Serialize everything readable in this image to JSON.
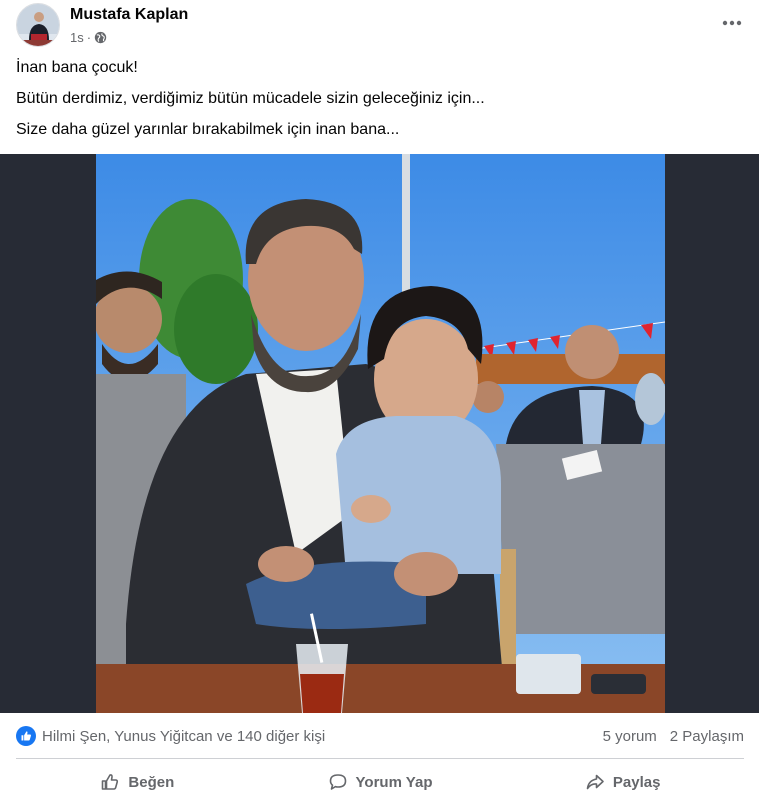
{
  "post": {
    "author": "Mustafa Kaplan",
    "time": "1s",
    "privacy_icon": "globe-icon",
    "menu_icon": "more-horizontal-icon",
    "lines": [
      "İnan bana çocuk!",
      "Bütün derdimiz, verdiğimiz bütün mücadele sizin geleceğiniz için...",
      "Size daha güzel yarınlar bırakabilmek için inan bana..."
    ]
  },
  "photo": {
    "subject": "man-holding-child-icon",
    "name_card": ""
  },
  "stats": {
    "reaction_icon": "like-icon",
    "reactors": "Hilmi Şen, Yunus Yiğitcan ve 140 diğer kişi",
    "comments": "5 yorum",
    "shares": "2 Paylaşım"
  },
  "actions": {
    "like": "Beğen",
    "comment": "Yorum Yap",
    "share": "Paylaş"
  },
  "colors": {
    "brand": "#1877f2",
    "secondary_text": "#65676b",
    "media_bg": "#272b35"
  }
}
